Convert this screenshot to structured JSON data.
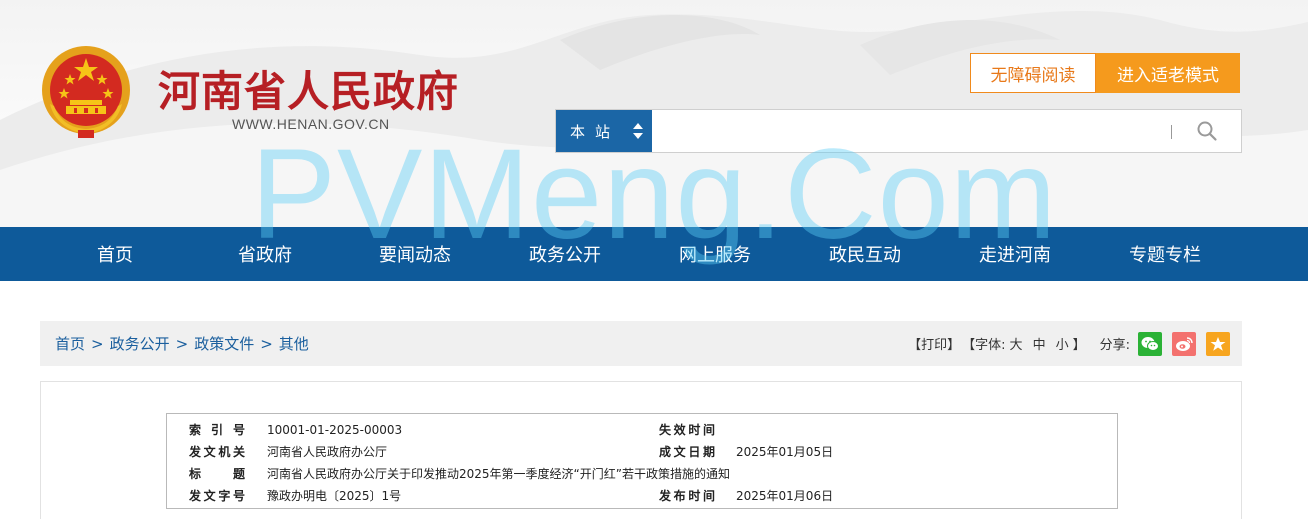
{
  "header": {
    "site_title": "河南省人民政府",
    "site_url": "WWW.HENAN.GOV.CN",
    "accessible_label": "无障碍阅读",
    "elder_mode_label": "进入适老模式",
    "search": {
      "scope_label": "本站",
      "placeholder": ""
    }
  },
  "nav": {
    "items": [
      "首页",
      "省政府",
      "要闻动态",
      "政务公开",
      "网上服务",
      "政民互动",
      "走进河南",
      "专题专栏"
    ]
  },
  "watermark": "PVMeng.Com",
  "breadcrumb": {
    "items": [
      "首页",
      "政务公开",
      "政策文件",
      "其他"
    ],
    "separator": ">"
  },
  "tools": {
    "print": "【打印】",
    "font_prefix": "【字体:",
    "font_large": "大",
    "font_medium": "中",
    "font_small": "小",
    "font_suffix": "】",
    "share_label": "分享:"
  },
  "meta": {
    "index_label": "索引号",
    "index_value": "10001-01-2025-00003",
    "expire_label": "失效时间",
    "expire_value": "",
    "issuer_label": "发文机关",
    "issuer_value": "河南省人民政府办公厅",
    "written_label": "成文日期",
    "written_value": "2025年01月05日",
    "title_label": "标题",
    "title_value": "河南省人民政府办公厅关于印发推动2025年第一季度经济“开门红”若干政策措施的通知",
    "docno_label": "发文字号",
    "docno_value": "豫政办明电〔2025〕1号",
    "publish_label": "发布时间",
    "publish_value": "2025年01月06日"
  },
  "colors": {
    "brand_red": "#b61f24",
    "nav_blue": "#0e5a9a",
    "accent_orange": "#f59a1d",
    "link_blue": "#1b5f9e"
  }
}
